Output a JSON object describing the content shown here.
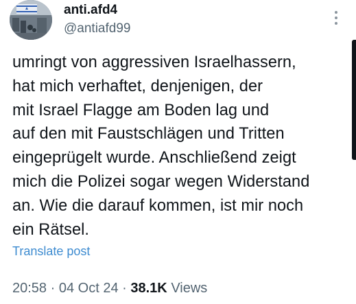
{
  "author": {
    "display_name": "anti.afd4",
    "handle": "@antiafd99"
  },
  "post": {
    "text": "umringt von aggressiven Israelhassern,\nhat mich verhaftet, denjenigen, der\nmit Israel Flagge am Boden lag und\nauf den mit Faustschlägen und Tritten\neingeprügelt wurde. Anschließend zeigt\nmich die Polizei sogar wegen Widerstand\nan. Wie die darauf kommen, ist mir noch\nein Rätsel.",
    "translate_label": "Translate post"
  },
  "meta": {
    "time": "20:58",
    "separator": "·",
    "date": "04 Oct 24",
    "views_count": "38.1K",
    "views_label": "Views"
  },
  "icons": {
    "more": "more-vertical-icon",
    "avatar": "profile-picture"
  },
  "colors": {
    "text_primary": "#0f1419",
    "text_secondary": "#536471",
    "link": "#3d8bd0"
  }
}
